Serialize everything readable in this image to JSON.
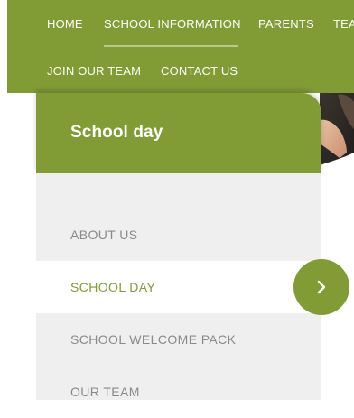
{
  "nav": {
    "items": [
      {
        "label": "HOME"
      },
      {
        "label": "SCHOOL INFORMATION"
      },
      {
        "label": "PARENTS"
      },
      {
        "label": "TEA"
      },
      {
        "label": "JOIN OUR TEAM"
      },
      {
        "label": "CONTACT US"
      }
    ],
    "active_index": 1
  },
  "sidebar": {
    "title": "School day",
    "items": [
      {
        "label": "ABOUT US"
      },
      {
        "label": "SCHOOL DAY"
      },
      {
        "label": "SCHOOL WELCOME PACK"
      },
      {
        "label": "OUR TEAM"
      }
    ],
    "active_index": 1
  },
  "arrow_button": {
    "icon": "chevron-right-icon"
  },
  "colors": {
    "brand_green": "#819b35",
    "menu_bg": "#efefef",
    "menu_text": "#8a8a8a",
    "white": "#ffffff"
  }
}
